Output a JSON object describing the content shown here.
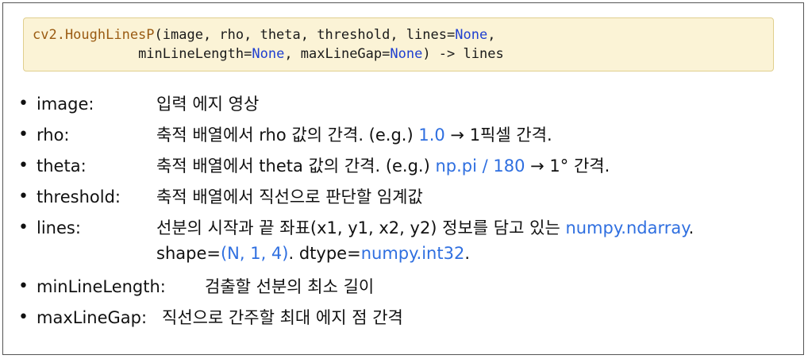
{
  "code": {
    "line1": {
      "fn": "cv2.HoughLinesP",
      "args": "(image, rho, theta, threshold, lines=",
      "none": "None",
      "tail": ","
    },
    "line2": {
      "indent": "             ",
      "p1": "minLineLength=",
      "none1": "None",
      "p2": ", maxLineGap=",
      "none2": "None",
      "tail": ") -> lines"
    }
  },
  "params": [
    {
      "name": "image:",
      "desc": "입력 에지 영상"
    },
    {
      "name": "rho:",
      "desc_pre": "축적 배열에서 rho 값의 간격. (e.g.) ",
      "desc_hl": "1.0",
      "desc_post": " → 1픽셀 간격."
    },
    {
      "name": "theta:",
      "desc_pre": "축적 배열에서 theta 값의 간격. (e.g.) ",
      "desc_hl": "np.pi / 180",
      "desc_post": " → 1° 간격."
    },
    {
      "name": "threshold:",
      "desc": "축적 배열에서 직선으로 판단할 임계값"
    },
    {
      "name": "lines:",
      "desc_pre": "선분의 시작과 끝 좌표(x1, y1, x2, y2) 정보를 담고 있는 ",
      "desc_hl": "numpy.ndarray",
      "desc_post": ".",
      "desc2_pre": "shape=",
      "desc2_hl": "(N, 1, 4)",
      "desc2_mid": ". dtype=",
      "desc2_hl2": "numpy.int32",
      "desc2_post": "."
    },
    {
      "name": "minLineLength:",
      "desc": "검출할 선분의 최소 길이"
    },
    {
      "name": "maxLineGap:",
      "desc": "직선으로 간주할 최대 에지 점 간격"
    }
  ],
  "bullet": "•"
}
